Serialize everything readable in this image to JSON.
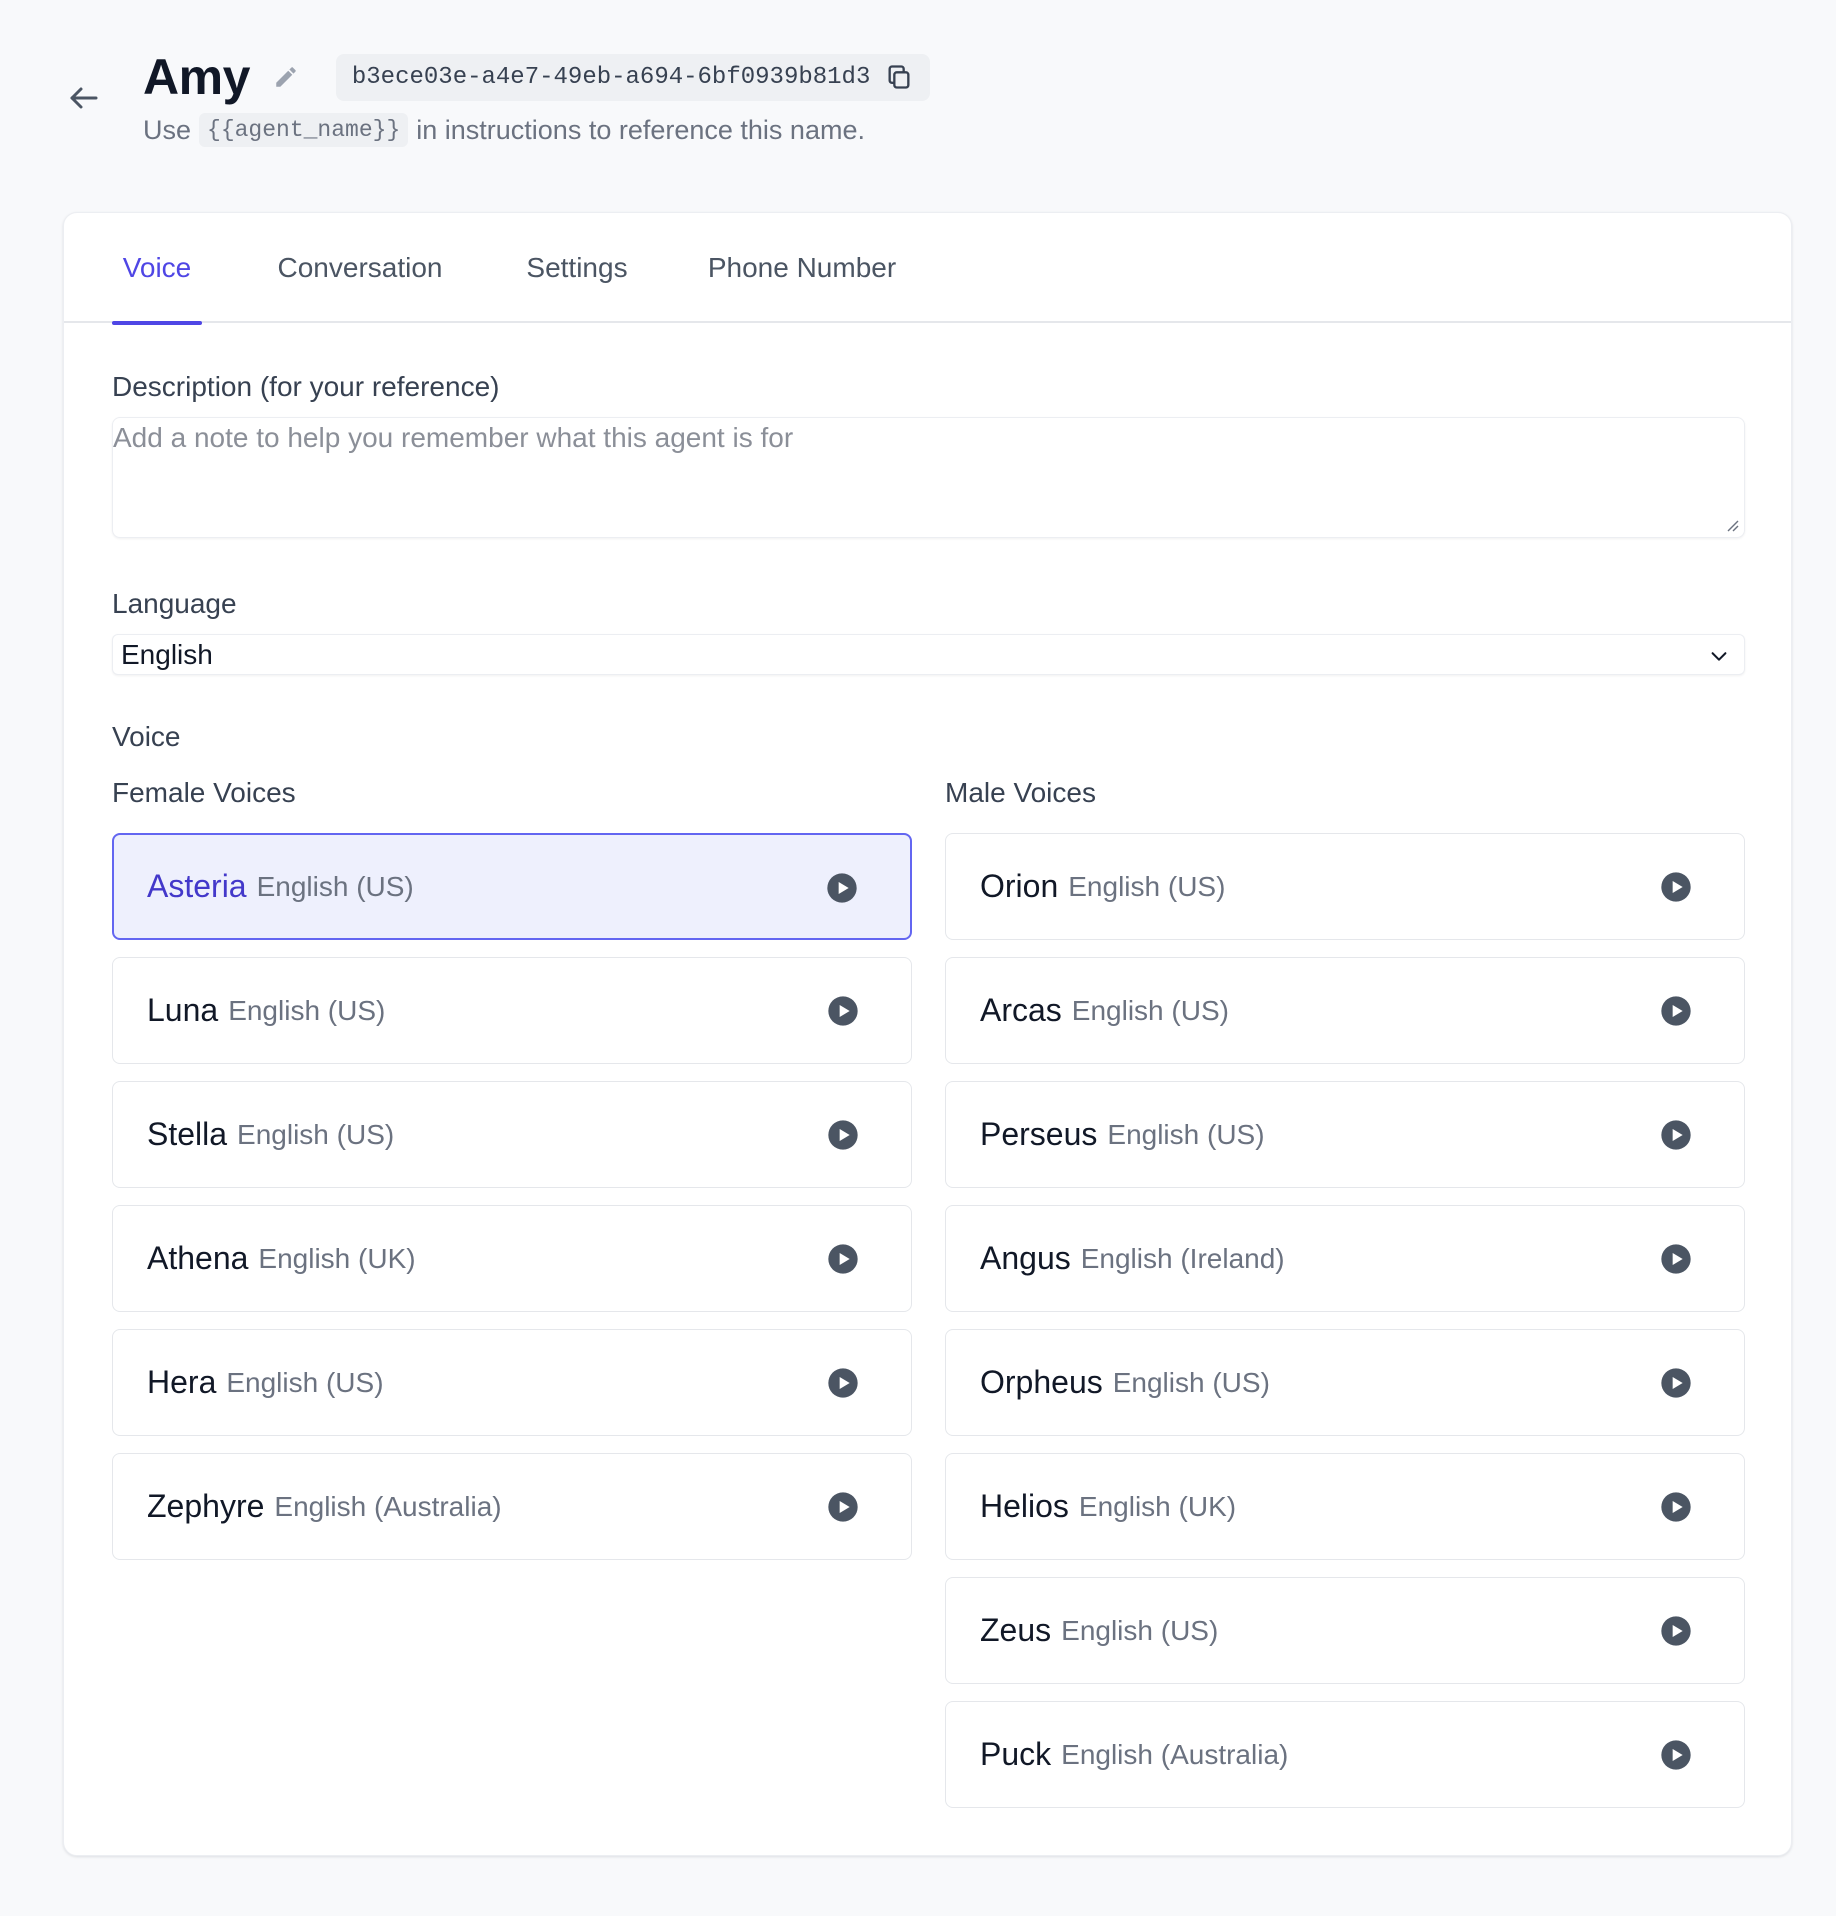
{
  "header": {
    "agent_name": "Amy",
    "agent_id": "b3ece03e-a4e7-49eb-a694-6bf0939b81d3",
    "hint_prefix": "Use",
    "hint_code": "{{agent_name}}",
    "hint_suffix": "in instructions to reference this name."
  },
  "tabs": [
    {
      "label": "Voice",
      "active": true
    },
    {
      "label": "Conversation",
      "active": false
    },
    {
      "label": "Settings",
      "active": false
    },
    {
      "label": "Phone Number",
      "active": false
    }
  ],
  "description": {
    "label": "Description (for your reference)",
    "placeholder": "Add a note to help you remember what this agent is for",
    "value": ""
  },
  "language": {
    "label": "Language",
    "selected": "English"
  },
  "voice": {
    "label": "Voice",
    "female_label": "Female Voices",
    "male_label": "Male Voices",
    "female": [
      {
        "name": "Asteria",
        "locale": "English (US)",
        "selected": true
      },
      {
        "name": "Luna",
        "locale": "English (US)",
        "selected": false
      },
      {
        "name": "Stella",
        "locale": "English (US)",
        "selected": false
      },
      {
        "name": "Athena",
        "locale": "English (UK)",
        "selected": false
      },
      {
        "name": "Hera",
        "locale": "English (US)",
        "selected": false
      },
      {
        "name": "Zephyre",
        "locale": "English (Australia)",
        "selected": false
      }
    ],
    "male": [
      {
        "name": "Orion",
        "locale": "English (US)",
        "selected": false
      },
      {
        "name": "Arcas",
        "locale": "English (US)",
        "selected": false
      },
      {
        "name": "Perseus",
        "locale": "English (US)",
        "selected": false
      },
      {
        "name": "Angus",
        "locale": "English (Ireland)",
        "selected": false
      },
      {
        "name": "Orpheus",
        "locale": "English (US)",
        "selected": false
      },
      {
        "name": "Helios",
        "locale": "English (UK)",
        "selected": false
      },
      {
        "name": "Zeus",
        "locale": "English (US)",
        "selected": false
      },
      {
        "name": "Puck",
        "locale": "English (Australia)",
        "selected": false
      }
    ]
  },
  "colors": {
    "accent": "#4f46e5",
    "selected_bg": "#eef0fd",
    "muted_text": "#6b7280"
  }
}
